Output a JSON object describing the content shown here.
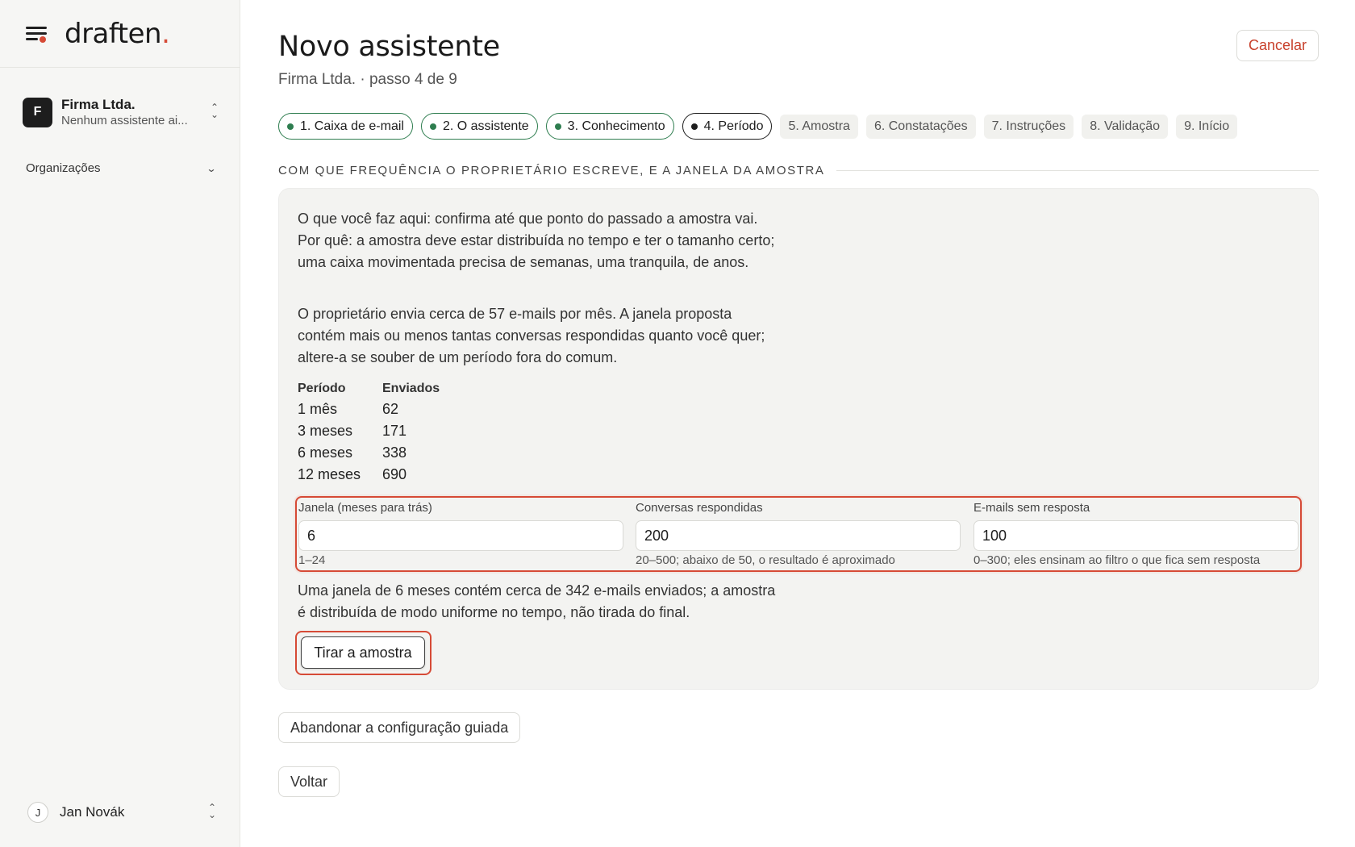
{
  "sidebar": {
    "brand": {
      "name": "draften",
      "dot": "."
    },
    "org": {
      "initial": "F",
      "name": "Firma Ltda.",
      "subtitle": "Nenhum assistente ai..."
    },
    "section_label": "Organizações",
    "user": {
      "initial": "J",
      "name": "Jan Novák"
    }
  },
  "header": {
    "title": "Novo assistente",
    "subtitle": "Firma Ltda. · passo 4 de 9",
    "cancel_label": "Cancelar"
  },
  "steps": [
    {
      "label": "1. Caixa de e-mail",
      "state": "done"
    },
    {
      "label": "2. O assistente",
      "state": "done"
    },
    {
      "label": "3. Conhecimento",
      "state": "done"
    },
    {
      "label": "4. Período",
      "state": "current"
    },
    {
      "label": "5. Amostra",
      "state": "todo"
    },
    {
      "label": "6. Constatações",
      "state": "todo"
    },
    {
      "label": "7. Instruções",
      "state": "todo"
    },
    {
      "label": "8. Validação",
      "state": "todo"
    },
    {
      "label": "9. Início",
      "state": "todo"
    }
  ],
  "section": {
    "title": "COM QUE FREQUÊNCIA O PROPRIETÁRIO ESCREVE, E A JANELA DA AMOSTRA",
    "intro": "O que você faz aqui: confirma até que ponto do passado a amostra vai. Por quê: a amostra deve estar distribuída no tempo e ter o tamanho certo; uma caixa movimentada precisa de semanas, uma tranquila, de anos.",
    "info": "O proprietário envia cerca de 57 e-mails por mês. A janela proposta contém mais ou menos tantas conversas respondidas quanto você quer; altere-a se souber de um período fora do comum.",
    "stats": {
      "headers": [
        "Período",
        "Enviados"
      ],
      "rows": [
        [
          "1 mês",
          "62"
        ],
        [
          "3 meses",
          "171"
        ],
        [
          "6 meses",
          "338"
        ],
        [
          "12 meses",
          "690"
        ]
      ]
    },
    "fields": {
      "window": {
        "label": "Janela (meses para trás)",
        "value": "6",
        "hint": "1–24"
      },
      "replied": {
        "label": "Conversas respondidas",
        "value": "200",
        "hint": "20–500; abaixo de 50, o resultado é aproximado"
      },
      "unanswered": {
        "label": "E-mails sem resposta",
        "value": "100",
        "hint": "0–300; eles ensinam ao filtro o que fica sem resposta"
      }
    },
    "summary": "Uma janela de 6 meses contém cerca de 342 e-mails enviados; a amostra é distribuída de modo uniforme no tempo, não tirada do final.",
    "sample_button": "Tirar a amostra"
  },
  "footer": {
    "abandon_label": "Abandonar a configuração guiada",
    "back_label": "Voltar"
  },
  "colors": {
    "accent": "#d64a36",
    "done": "#2e7d4f",
    "card_bg": "#f3f3f1",
    "sidebar_bg": "#f6f6f4"
  }
}
